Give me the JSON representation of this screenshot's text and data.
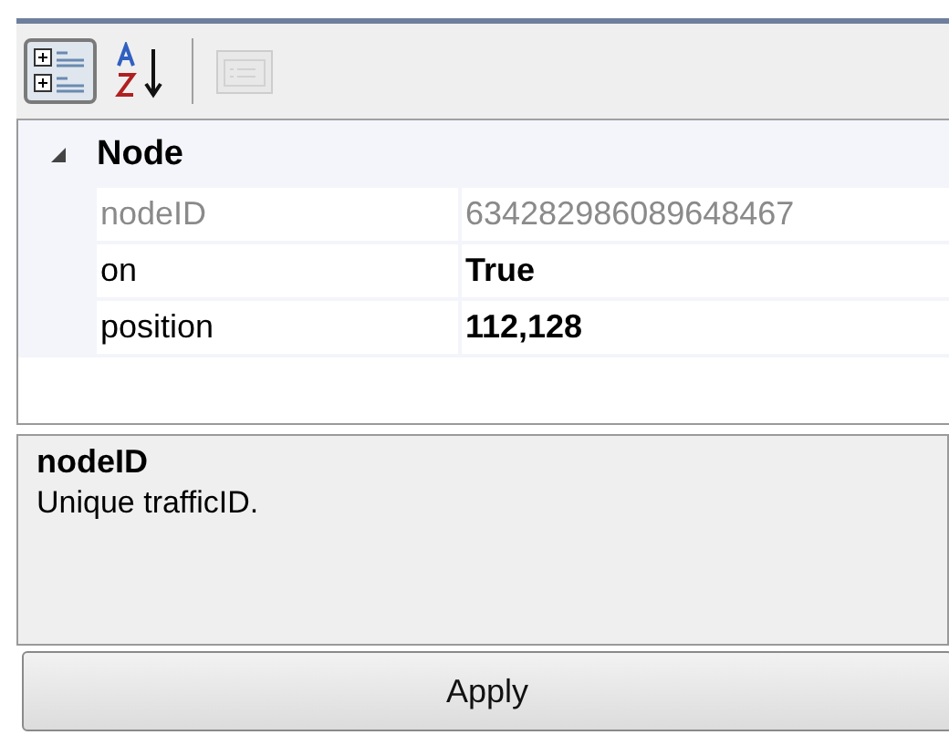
{
  "toolbar": [
    {
      "kind": "categorized",
      "selected": true,
      "disabled": false
    },
    {
      "kind": "alphabetical",
      "selected": false,
      "disabled": false
    },
    {
      "kind": "pages",
      "selected": false,
      "disabled": true
    }
  ],
  "category": {
    "name": "Node",
    "expanded": true,
    "properties": [
      {
        "name": "nodeID",
        "value": "634282986089648467",
        "readonly": true,
        "modified": false
      },
      {
        "name": "on",
        "value": "True",
        "readonly": false,
        "modified": true
      },
      {
        "name": "position",
        "value": "112,128",
        "readonly": false,
        "modified": true
      }
    ]
  },
  "description": {
    "title": "nodeID",
    "text": "Unique trafficID."
  },
  "button": "Apply"
}
